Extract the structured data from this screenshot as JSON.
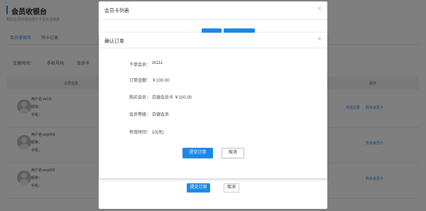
{
  "page": {
    "title": "会员收银台",
    "subtitle": "帮助会员快捷完成开卡及充值缴费",
    "tabs": [
      "会员收银台",
      "购卡记录"
    ],
    "filters": [
      "注册时间：",
      "手机号码",
      "会员卡"
    ],
    "table": {
      "col_member": "会员信息",
      "col_actions": "操作"
    },
    "rows": [
      {
        "name": "用户名:zk111",
        "line2": "昵称：",
        "line3": "手机：",
        "action1": "充值记录",
        "action2": "购买会员卡"
      },
      {
        "name": "用户名:wuy003",
        "line2": "昵称：",
        "line3": "手机：",
        "action1": "",
        "action2": "购买会员卡"
      },
      {
        "name": "用户名:wuy002",
        "line2": "昵称：",
        "line3": "手机：",
        "action1": "",
        "action2": "购买会员卡"
      }
    ]
  },
  "mid_dialog": {
    "title": "会员卡列表",
    "close_glyph": "×",
    "submit_label": "提交订单",
    "cancel_label": "取消"
  },
  "confirm_dialog": {
    "title": "确认订单",
    "close_glyph": "×",
    "fields": [
      {
        "label": "下单会员：",
        "value": "zk111"
      },
      {
        "label": "订单金额：",
        "value": "￥100.00"
      },
      {
        "label": "购买会员：",
        "value": "白银会员卡   ￥100.00"
      },
      {
        "label": "会员等级：",
        "value": "白银会员"
      },
      {
        "label": "有效时间：",
        "value": "10(天)"
      }
    ],
    "submit_label": "提交订单",
    "cancel_label": "取消"
  },
  "colors": {
    "primary": "#1e88e5",
    "overlay": "rgba(0,0,0,0.5)"
  }
}
